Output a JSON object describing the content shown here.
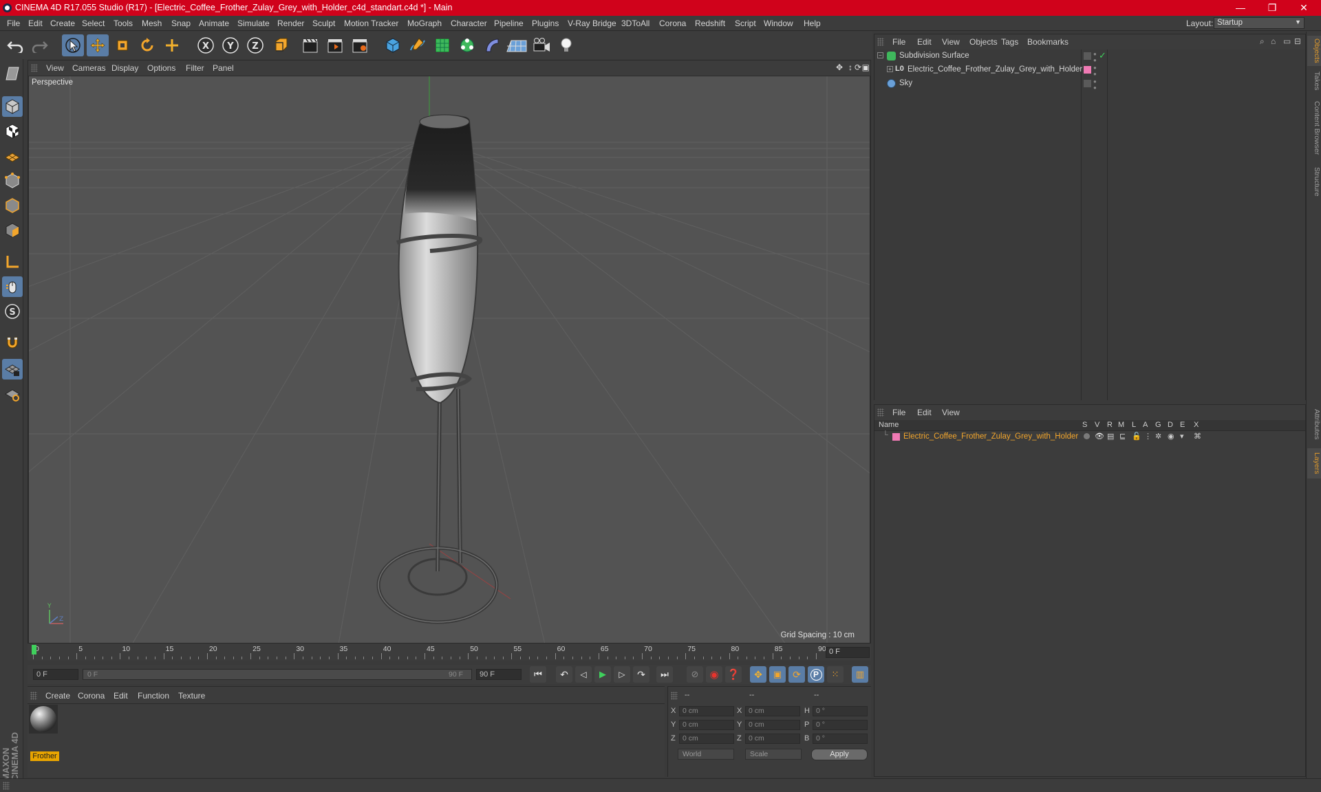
{
  "window": {
    "title": "CINEMA 4D R17.055 Studio (R17) - [Electric_Coffee_Frother_Zulay_Grey_with_Holder_c4d_standart.c4d *] - Main",
    "minimize": "—",
    "maximize": "❐",
    "close": "✕"
  },
  "menubar": {
    "items": [
      "File",
      "Edit",
      "Create",
      "Select",
      "Tools",
      "Mesh",
      "Snap",
      "Animate",
      "Simulate",
      "Render",
      "Sculpt",
      "Motion Tracker",
      "MoGraph",
      "Character",
      "Pipeline",
      "Plugins",
      "V-Ray Bridge",
      "3DToAll",
      "Corona",
      "Redshift",
      "Script",
      "Window",
      "Help"
    ],
    "layout_label": "Layout:",
    "layout_value": "Startup"
  },
  "viewport": {
    "menu": [
      "View",
      "Cameras",
      "Display",
      "Options",
      "Filter",
      "Panel"
    ],
    "label": "Perspective",
    "grid_spacing": "Grid Spacing : 10 cm"
  },
  "timeline": {
    "ticks": [
      "0",
      "5",
      "10",
      "15",
      "20",
      "25",
      "30",
      "35",
      "40",
      "45",
      "50",
      "55",
      "60",
      "65",
      "70",
      "75",
      "80",
      "85",
      "90"
    ],
    "current_frame": "0 F",
    "start_field": "0 F",
    "range_start": "0 F",
    "range_end": "90 F",
    "end_field": "90 F"
  },
  "material_manager": {
    "menu": [
      "Create",
      "Corona",
      "Edit",
      "Function",
      "Texture"
    ],
    "materials": [
      {
        "name": "Frother"
      }
    ]
  },
  "coordinates": {
    "headers": [
      "--",
      "--",
      "--"
    ],
    "rows": [
      {
        "a": "X",
        "av": "0 cm",
        "b": "X",
        "bv": "0 cm",
        "c": "H",
        "cv": "0 °"
      },
      {
        "a": "Y",
        "av": "0 cm",
        "b": "Y",
        "bv": "0 cm",
        "c": "P",
        "cv": "0 °"
      },
      {
        "a": "Z",
        "av": "0 cm",
        "b": "Z",
        "bv": "0 cm",
        "c": "B",
        "cv": "0 °"
      }
    ],
    "mode": "World",
    "size_mode": "Scale",
    "apply": "Apply"
  },
  "object_manager": {
    "menu": [
      "File",
      "Edit",
      "View",
      "Objects",
      "Tags",
      "Bookmarks"
    ],
    "objects": [
      {
        "name": "Subdivision Surface"
      },
      {
        "name": "Electric_Coffee_Frother_Zulay_Grey_with_Holder"
      },
      {
        "name": "Sky"
      }
    ]
  },
  "layer_manager": {
    "menu": [
      "File",
      "Edit",
      "View"
    ],
    "columns": [
      "Name",
      "S",
      "V",
      "R",
      "M",
      "L",
      "A",
      "G",
      "D",
      "E",
      "X"
    ],
    "layers": [
      {
        "name": "Electric_Coffee_Frother_Zulay_Grey_with_Holder"
      }
    ]
  },
  "right_tabs": [
    "Objects",
    "Takes",
    "Content Browser",
    "Structure",
    "Attributes",
    "Layers"
  ],
  "colors": {
    "title_bar": "#d0021b",
    "selection": "#5a7da6",
    "accent_orange": "#e8a400",
    "layer_pink": "#f07ab4"
  }
}
